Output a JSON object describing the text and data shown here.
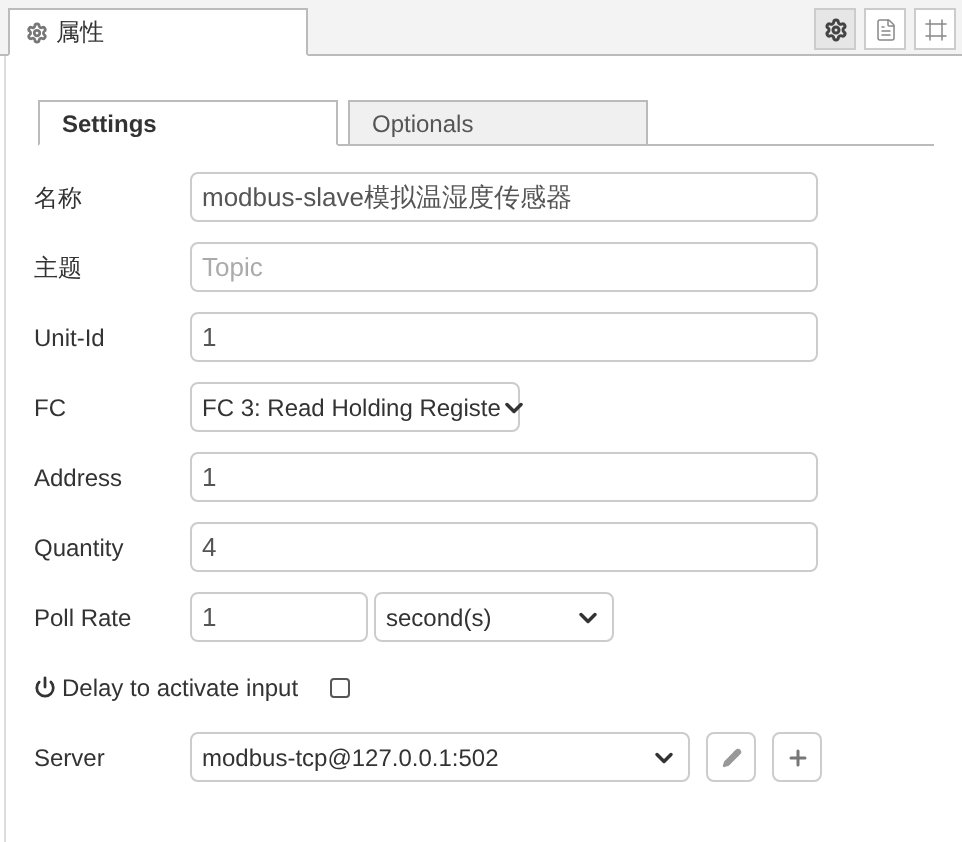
{
  "panel_tab": {
    "label": "属性"
  },
  "toolbar": [
    {
      "kind": "gear",
      "selected": true
    },
    {
      "kind": "doc",
      "selected": false
    },
    {
      "kind": "frame",
      "selected": false
    }
  ],
  "tabs": [
    {
      "label": "Settings",
      "selected": true
    },
    {
      "label": "Optionals",
      "selected": false
    }
  ],
  "fields": [
    {
      "kind": "text",
      "label": "名称",
      "value": "modbus-slave模拟温湿度传感器"
    },
    {
      "kind": "text",
      "label": "主题",
      "placeholder": "Topic"
    },
    {
      "kind": "text",
      "label": "Unit-Id",
      "value": "1"
    },
    {
      "kind": "select",
      "label": "FC",
      "value": "FC 3: Read Holding Registe"
    },
    {
      "kind": "text",
      "label": "Address",
      "value": "1"
    },
    {
      "kind": "text",
      "label": "Quantity",
      "value": "4"
    },
    {
      "kind": "rate",
      "label": "Poll Rate",
      "value": "1",
      "unit": "second(s)"
    },
    {
      "kind": "checkbox",
      "label": "Delay to activate input",
      "checked": false
    },
    {
      "kind": "server",
      "label": "Server",
      "value": "modbus-tcp@127.0.0.1:502"
    }
  ]
}
